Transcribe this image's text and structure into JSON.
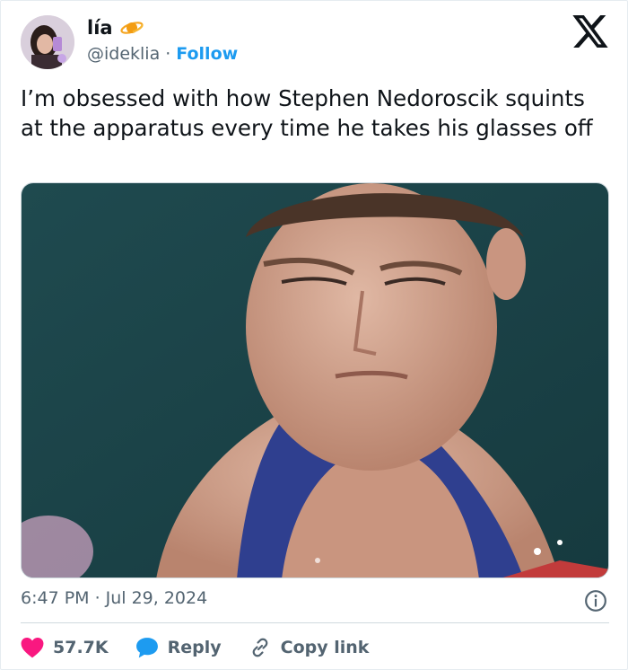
{
  "user": {
    "display_name": "lía",
    "handle": "@ideklia",
    "separator": "·",
    "follow_label": "Follow"
  },
  "tweet": {
    "text": "I’m obsessed with how Stephen Nedoroscik squints at the apparatus every time he takes his glasses off",
    "time": "6:47 PM",
    "date_separator": "·",
    "date": "Jul 29, 2024"
  },
  "actions": {
    "likes_count": "57.7K",
    "reply_label": "Reply",
    "copy_link_label": "Copy link"
  },
  "icons": {
    "verified_badge": "planet-emoji",
    "brand": "x-logo-icon",
    "info": "info-icon",
    "like": "heart-icon",
    "reply": "reply-bubble-icon",
    "copy": "link-icon"
  },
  "colors": {
    "accent": "#1d9bf0",
    "like": "#f91880",
    "text": "#0f1419",
    "muted": "#536471",
    "border": "#cfd9de"
  }
}
